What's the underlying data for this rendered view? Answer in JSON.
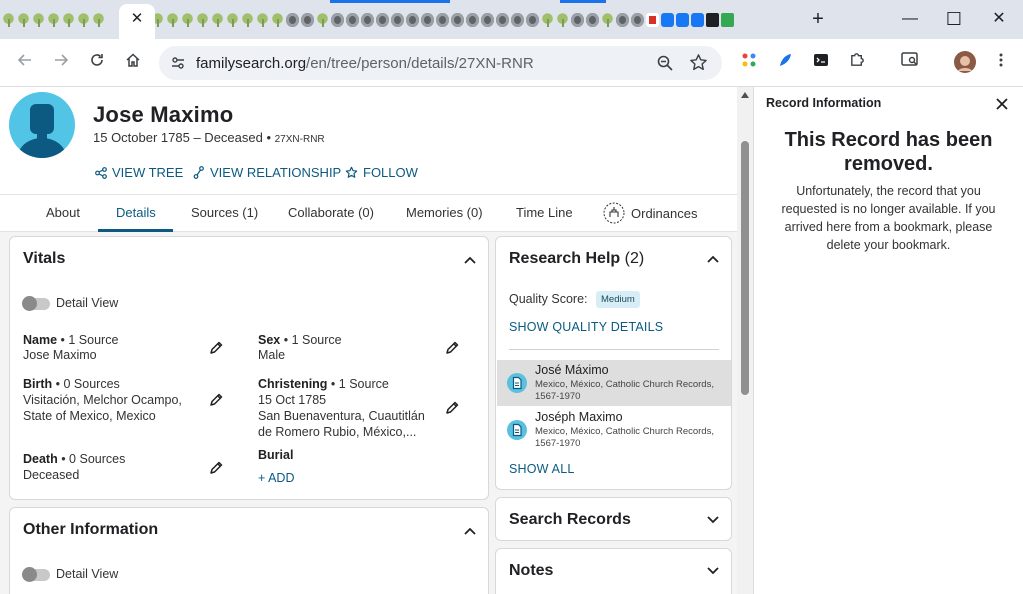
{
  "browser": {
    "url_domain": "familysearch.org",
    "url_path": "/en/tree/person/details/27XN-RNR",
    "tab_close": "✕",
    "new_tab": "+",
    "win_min": "—",
    "win_max": "☐",
    "win_close": "✕"
  },
  "person": {
    "name": "Jose Maximo",
    "lifespan": "15 October 1785 – Deceased",
    "id": "27XN-RNR"
  },
  "actions": {
    "view_tree": "VIEW TREE",
    "view_relationship": "VIEW RELATIONSHIP",
    "follow": "FOLLOW"
  },
  "tabs": [
    "About",
    "Details",
    "Sources (1)",
    "Collaborate (0)",
    "Memories (0)",
    "Time Line",
    "Ordinances"
  ],
  "vitals": {
    "title": "Vitals",
    "detail_view": "Detail View",
    "name_label": "Name",
    "name_sources": " • 1 Source",
    "name_value": "Jose Maximo",
    "sex_label": "Sex",
    "sex_sources": " • 1 Source",
    "sex_value": "Male",
    "birth_label": "Birth",
    "birth_sources": " • 0 Sources",
    "birth_value_1": "Visitación, Melchor Ocampo,",
    "birth_value_2": "State of Mexico, Mexico",
    "christening_label": "Christening",
    "christening_sources": " • 1 Source",
    "christening_date": "15 Oct 1785",
    "christening_place_1": "San Buenaventura, Cuautitlán",
    "christening_place_2": "de Romero Rubio, México,...",
    "death_label": "Death",
    "death_sources": " • 0 Sources",
    "death_value": "Deceased",
    "burial_label": "Burial",
    "burial_add": "+  ADD"
  },
  "other_info": {
    "title": "Other Information",
    "detail_view": "Detail View"
  },
  "research_help": {
    "title": "Research Help",
    "count": " (2)",
    "quality_label": "Quality Score:",
    "quality_value": "Medium",
    "show_quality": "SHOW QUALITY DETAILS",
    "records": [
      {
        "name": "José Máximo",
        "desc": "Mexico, México, Catholic Church Records, 1567-1970"
      },
      {
        "name": "Joséph Maximo",
        "desc": "Mexico, México, Catholic Church Records, 1567-1970"
      }
    ],
    "show_all": "SHOW ALL"
  },
  "search_records": {
    "title": "Search Records"
  },
  "notes": {
    "title": "Notes"
  },
  "side_panel": {
    "title": "Record Information",
    "heading": "This Record has been removed.",
    "body": "Unfortunately, the record that you requested is no longer available. If you arrived here from a bookmark, please delete your bookmark."
  }
}
